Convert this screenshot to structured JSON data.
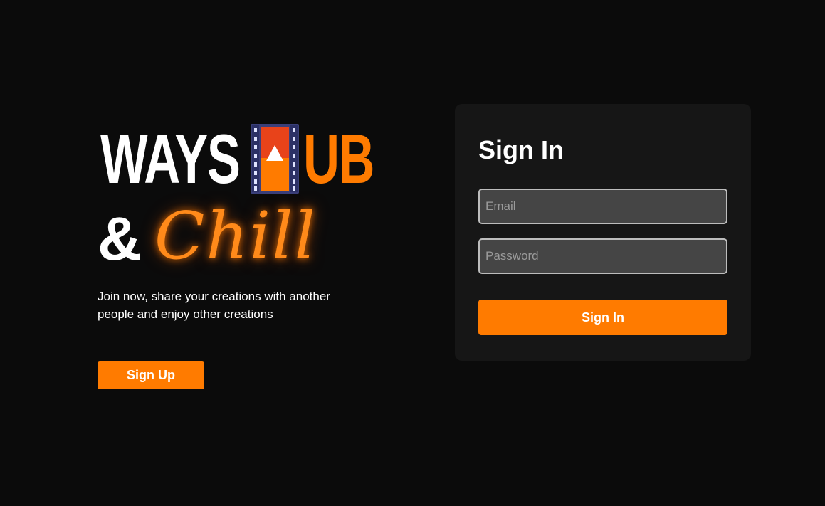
{
  "brand": {
    "logo_word_left": "WAYS",
    "logo_word_right": "UB",
    "logo_ampersand": "&",
    "logo_script": "Chill",
    "logo_icon": "film-strip-play-icon",
    "tagline": "Join now, share your creations with another people and enjoy other creations",
    "signup_label": "Sign Up"
  },
  "signin": {
    "title": "Sign In",
    "email_placeholder": "Email",
    "password_placeholder": "Password",
    "submit_label": "Sign In"
  },
  "colors": {
    "background": "#0b0b0b",
    "card": "#161616",
    "accent": "#ff7b00",
    "input_bg": "#454545",
    "input_border": "#bdbdbd",
    "text": "#ffffff"
  }
}
